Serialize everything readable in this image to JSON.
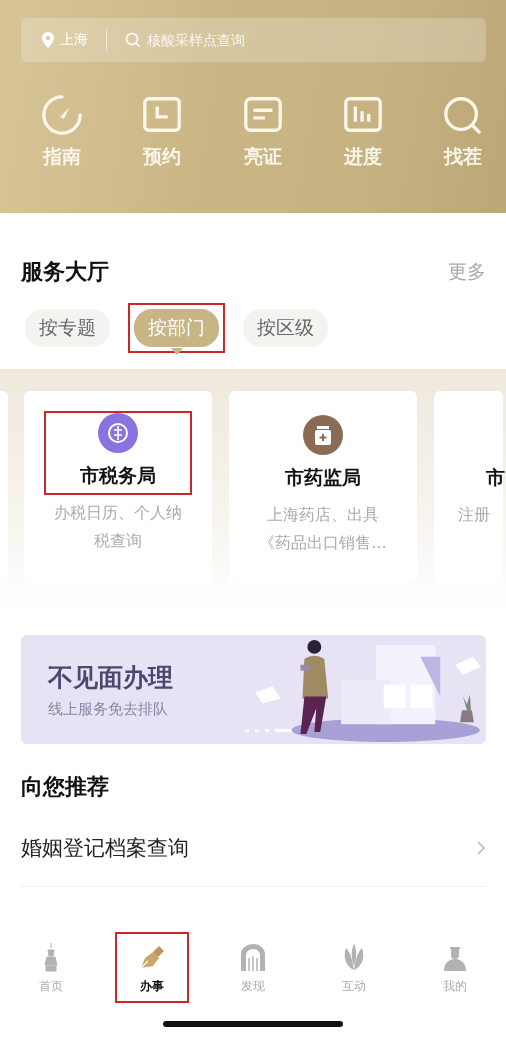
{
  "header": {
    "city": "上海",
    "search": {
      "placeholder": "核酸采样点查询"
    },
    "shortcuts": [
      {
        "kind": "gauge",
        "label": "指南"
      },
      {
        "kind": "clock",
        "label": "预约"
      },
      {
        "kind": "card",
        "label": "亮证"
      },
      {
        "kind": "bars",
        "label": "进度"
      },
      {
        "kind": "search",
        "label": "找茬"
      }
    ]
  },
  "service_hall": {
    "title": "服务大厅",
    "more": "更多",
    "tabs": [
      {
        "label": "按专题",
        "selected": false
      },
      {
        "label": "按部门",
        "selected": true
      },
      {
        "label": "按区级",
        "selected": false
      }
    ],
    "departments": [
      {
        "kind": "tax",
        "name": "市税务局",
        "desc": "办税日历、个人纳税查询",
        "highlighted": true
      },
      {
        "kind": "drug",
        "name": "市药监局",
        "desc": "上海药店、出具《药品出口销售...",
        "highlighted": false
      },
      {
        "kind": "cut",
        "name": "市",
        "desc": "注册",
        "highlighted": false
      }
    ]
  },
  "banner": {
    "title": "不见面办理",
    "subtitle": "线上服务免去排队",
    "pages": [
      {
        "selected": false
      },
      {
        "selected": false
      },
      {
        "selected": false
      },
      {
        "selected": true
      }
    ]
  },
  "recommend": {
    "title": "向您推荐",
    "items": [
      {
        "label": "婚姻登记档案查询"
      }
    ]
  },
  "tab_bar": [
    {
      "kind": "tower",
      "label": "首页",
      "selected": false
    },
    {
      "kind": "pen",
      "label": "办事",
      "selected": true
    },
    {
      "kind": "arch",
      "label": "发现",
      "selected": false
    },
    {
      "kind": "lotus",
      "label": "互动",
      "selected": false
    },
    {
      "kind": "person",
      "label": "我的",
      "selected": false
    }
  ]
}
